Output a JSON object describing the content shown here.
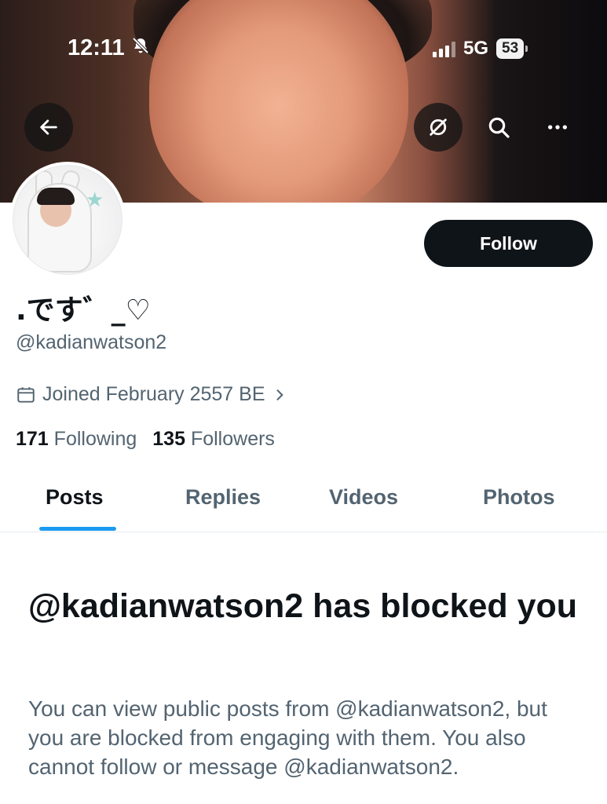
{
  "status_bar": {
    "time": "12:11",
    "network": "5G",
    "battery": "53",
    "icons": [
      "bell-slash-icon",
      "signal-icon"
    ]
  },
  "header": {
    "buttons": [
      "back-arrow-icon",
      "grok-icon",
      "search-icon",
      "more-icon"
    ]
  },
  "profile": {
    "display_name": ".です゛_♡",
    "handle": "@kadianwatson2",
    "joined": "Joined February 2557 BE",
    "following_count": "171",
    "following_label": "Following",
    "followers_count": "135",
    "followers_label": "Followers",
    "follow_label": "Follow"
  },
  "tabs": [
    {
      "label": "Posts",
      "active": true
    },
    {
      "label": "Replies",
      "active": false
    },
    {
      "label": "Videos",
      "active": false
    },
    {
      "label": "Photos",
      "active": false
    }
  ],
  "blocked": {
    "title": "@kadianwatson2 has blocked you",
    "body": "You can view public posts from @kadianwatson2, but you are blocked from engaging with them. You also cannot follow or message @kadianwatson2."
  },
  "colors": {
    "accent": "#1d9bf0",
    "text_primary": "#0f1419",
    "text_secondary": "#536471",
    "button_dark": "#0f1419"
  }
}
